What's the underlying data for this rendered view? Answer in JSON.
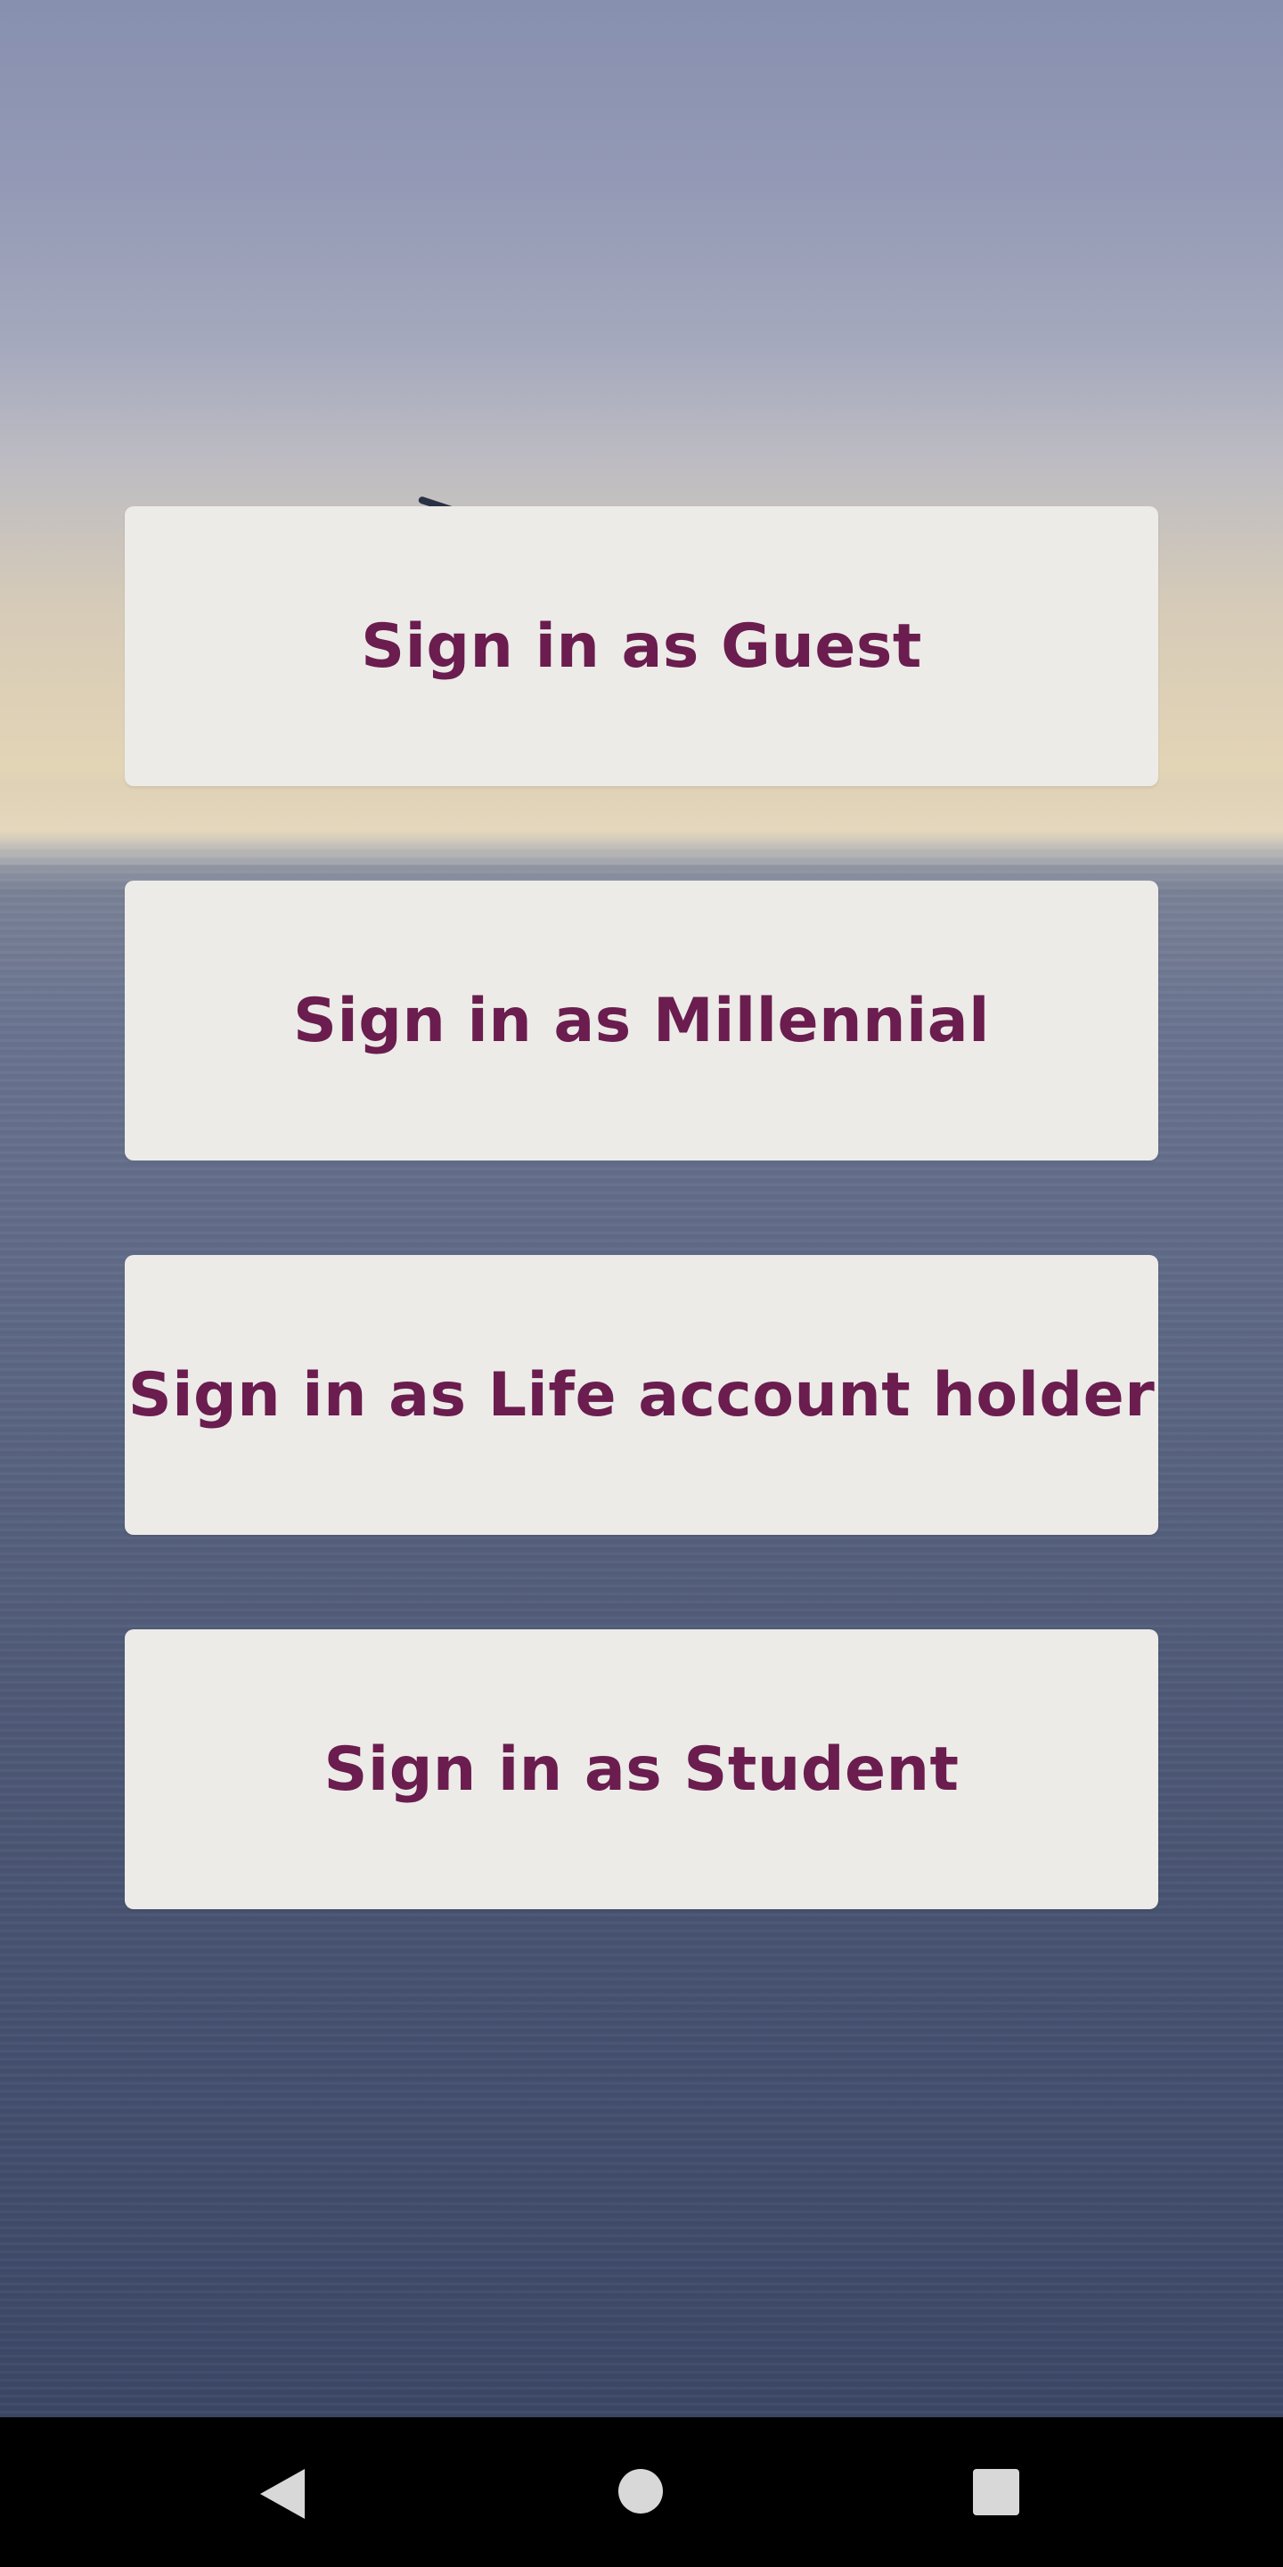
{
  "signin": {
    "options": [
      {
        "label": "Sign in as Guest"
      },
      {
        "label": "Sign in as Millennial"
      },
      {
        "label": "Sign in as Life account holder"
      },
      {
        "label": "Sign in as Student"
      }
    ],
    "button_background": "#ecebe7",
    "label_color": "#6a1d4e"
  },
  "navbar": {
    "back_icon": "back-triangle-icon",
    "home_icon": "home-circle-icon",
    "recents_icon": "recents-square-icon"
  }
}
